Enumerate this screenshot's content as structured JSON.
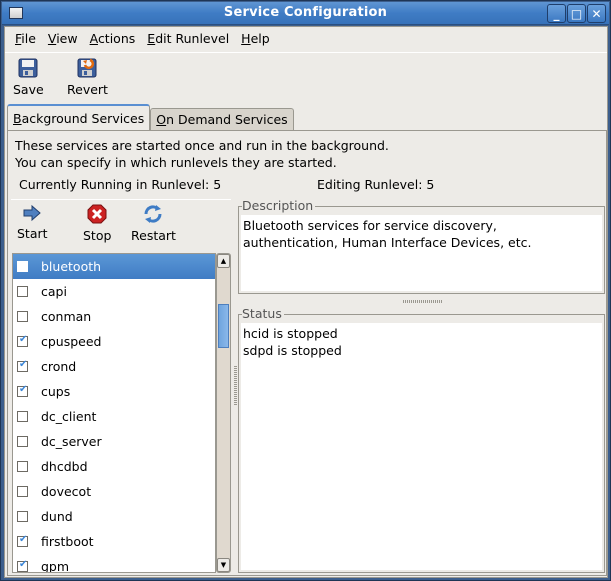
{
  "window": {
    "title": "Service Configuration",
    "controls": [
      "minimize",
      "maximize",
      "close"
    ]
  },
  "menubar": {
    "items": [
      {
        "label": "File",
        "mnemonic": "F"
      },
      {
        "label": "View",
        "mnemonic": "V"
      },
      {
        "label": "Actions",
        "mnemonic": "A"
      },
      {
        "label": "Edit Runlevel",
        "mnemonic": "E"
      },
      {
        "label": "Help",
        "mnemonic": "H"
      }
    ]
  },
  "toolbar": {
    "save_label": "Save",
    "revert_label": "Revert"
  },
  "tabs": [
    {
      "label": "Background Services",
      "active": true
    },
    {
      "label": "On Demand Services",
      "active": false
    }
  ],
  "background": {
    "intro_line1": "These services are started once and run in the background.",
    "intro_line2": "You can specify in which runlevels they are started.",
    "current_runlevel": "Currently Running in Runlevel: 5",
    "editing_runlevel": "Editing Runlevel: 5",
    "service_actions": {
      "start_label": "Start",
      "stop_label": "Stop",
      "restart_label": "Restart"
    },
    "services": [
      {
        "name": "bluetooth",
        "enabled": false,
        "selected": true
      },
      {
        "name": "capi",
        "enabled": false
      },
      {
        "name": "conman",
        "enabled": false
      },
      {
        "name": "cpuspeed",
        "enabled": true
      },
      {
        "name": "crond",
        "enabled": true
      },
      {
        "name": "cups",
        "enabled": true
      },
      {
        "name": "dc_client",
        "enabled": false
      },
      {
        "name": "dc_server",
        "enabled": false
      },
      {
        "name": "dhcdbd",
        "enabled": false
      },
      {
        "name": "dovecot",
        "enabled": false
      },
      {
        "name": "dund",
        "enabled": false
      },
      {
        "name": "firstboot",
        "enabled": true
      },
      {
        "name": "gpm",
        "enabled": true
      }
    ],
    "description_label": "Description",
    "description_line1": "Bluetooth services for service discovery,",
    "description_line2": "authentication, Human Interface Devices, etc.",
    "status_label": "Status",
    "status_line1": "hcid is stopped",
    "status_line2": "sdpd is stopped"
  },
  "colors": {
    "titlebar": "#3f7cc5",
    "selection": "#4a88cc",
    "check": "#3b86d8",
    "stop_icon": "#cc2222"
  }
}
